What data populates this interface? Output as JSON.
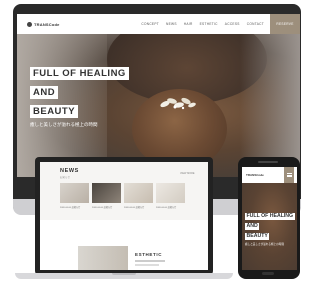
{
  "site": {
    "logo": "TRANSCode",
    "nav": [
      "CONCEPT",
      "NEWS",
      "HAIR",
      "ESTHETIC",
      "ACCESS",
      "CONTACT"
    ],
    "reserve_label": "RESERVE"
  },
  "hero": {
    "title_line1": "FULL OF HEALING",
    "title_line2": "AND",
    "title_line3": "BEAUTY",
    "subtitle": "癒しと美しさが溢れる極上の時間"
  },
  "laptop": {
    "news_title": "NEWS",
    "news_sub": "お知らせ",
    "news_more": "VIEW MORE",
    "news_items": [
      {
        "caption": "2020.00.00 お知らせ"
      },
      {
        "caption": "2020.00.00 お知らせ"
      },
      {
        "caption": "2020.00.00 お知らせ"
      },
      {
        "caption": "2020.00.00 お知らせ"
      }
    ],
    "esthetic_title": "ESTHETIC"
  },
  "phone": {
    "logo": "TRANSCode",
    "title_line1": "FULL OF HEALING",
    "title_line2": "AND",
    "title_line3": "BEAUTY",
    "subtitle": "癒しと美しさが溢れる極上の時間"
  },
  "colors": {
    "accent": "#9d8f7c",
    "device_frame": "#222222",
    "hero_brown": "#6b4a33"
  }
}
